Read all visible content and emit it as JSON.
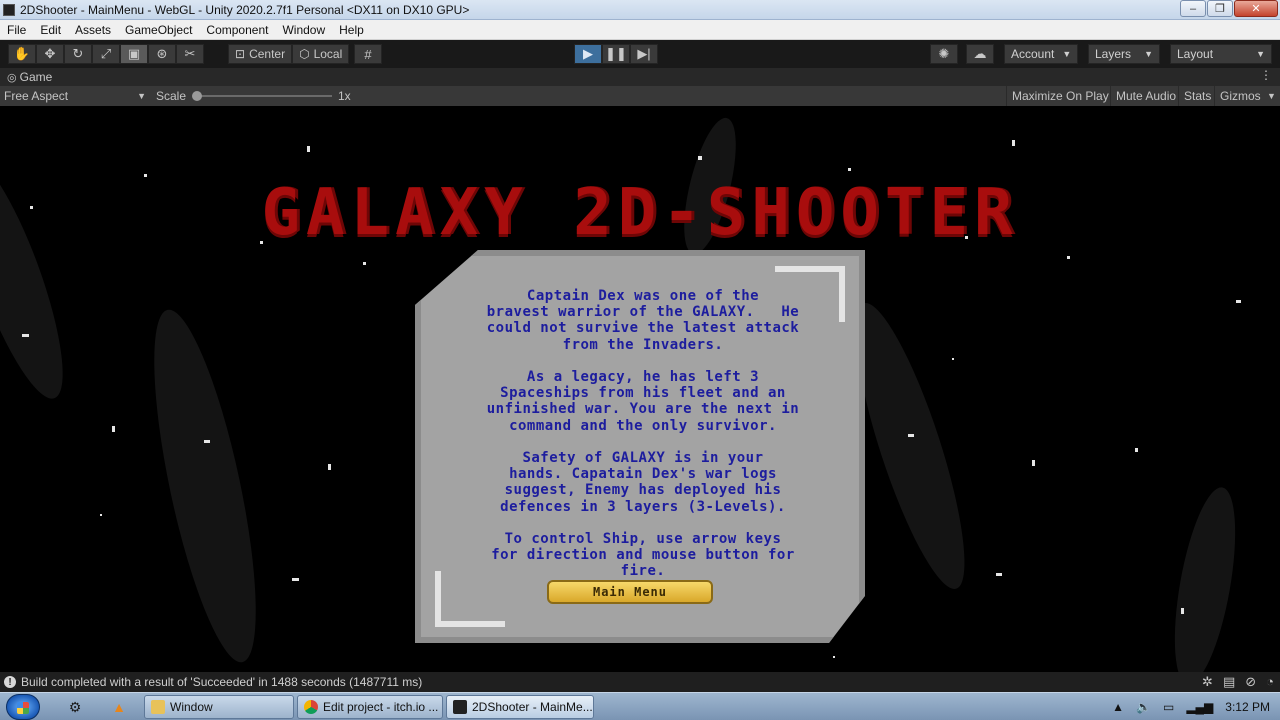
{
  "window": {
    "title": "2DShooter - MainMenu - WebGL - Unity 2020.2.7f1 Personal <DX11 on DX10 GPU>",
    "controls": [
      "‒",
      "❐",
      "✕"
    ]
  },
  "menu": [
    "File",
    "Edit",
    "Assets",
    "GameObject",
    "Component",
    "Window",
    "Help"
  ],
  "toolbar": {
    "pivot": "Center",
    "space": "Local",
    "account": "Account",
    "layers": "Layers",
    "layout": "Layout"
  },
  "game_tab": {
    "label": "Game"
  },
  "game_bar": {
    "aspect": "Free Aspect",
    "scale_label": "Scale",
    "scale_value": "1x",
    "maximize": "Maximize On Play",
    "mute": "Mute Audio",
    "stats": "Stats",
    "gizmos": "Gizmos"
  },
  "game": {
    "title": "GALAXY 2D-SHOOTER",
    "story": "Captain Dex was one of the\nbravest warrior of the GALAXY.   He\ncould not survive the latest attack\nfrom the Invaders.\n\nAs a legacy, he has left 3\nSpaceships from his fleet and an\nunfinished war. You are the next in\ncommand and the only survivor.\n\nSafety of GALAXY is in your\nhands. Capatain Dex's war logs\nsuggest, Enemy has deployed his\ndefences in 3 layers (3-Levels).\n\nTo control Ship, use arrow keys\nfor direction and mouse button for\nfire.",
    "main_menu_button": "Main Menu",
    "title_color": "#a80d0d",
    "text_color": "#1d1d9e"
  },
  "status": {
    "message": "Build completed with a result of 'Succeeded' in 1488 seconds (1487711 ms)"
  },
  "taskbar": {
    "items": [
      {
        "label": "Window",
        "icon": "folder-icon"
      },
      {
        "label": "Edit project - itch.io ...",
        "icon": "chrome-icon"
      },
      {
        "label": "2DShooter - MainMe...",
        "icon": "unity-icon"
      }
    ],
    "clock": "3:12 PM"
  },
  "colors": {
    "play_button": "#3d6f9d"
  }
}
